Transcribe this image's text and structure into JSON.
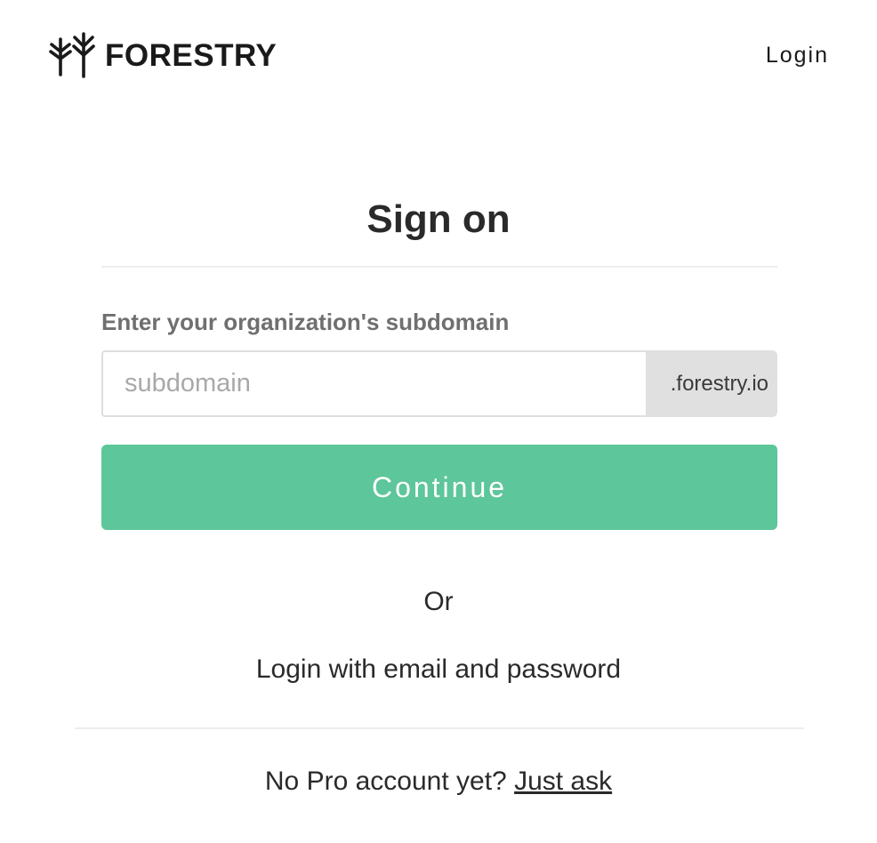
{
  "header": {
    "brand": "FORESTRY",
    "login_label": "Login"
  },
  "main": {
    "title": "Sign on",
    "field_label": "Enter your organization's subdomain",
    "subdomain_placeholder": "subdomain",
    "subdomain_value": "",
    "subdomain_suffix": ".forestry.io",
    "continue_label": "Continue",
    "or_label": "Or",
    "email_login_label": "Login with email and password"
  },
  "footer": {
    "prompt": "No Pro account yet?",
    "link_label": "Just ask"
  },
  "colors": {
    "accent": "#5dc69a",
    "suffix_bg": "#e0e0e0",
    "label_gray": "#6f6f6f"
  },
  "icons": {
    "logo": "forestry-trees-icon"
  }
}
